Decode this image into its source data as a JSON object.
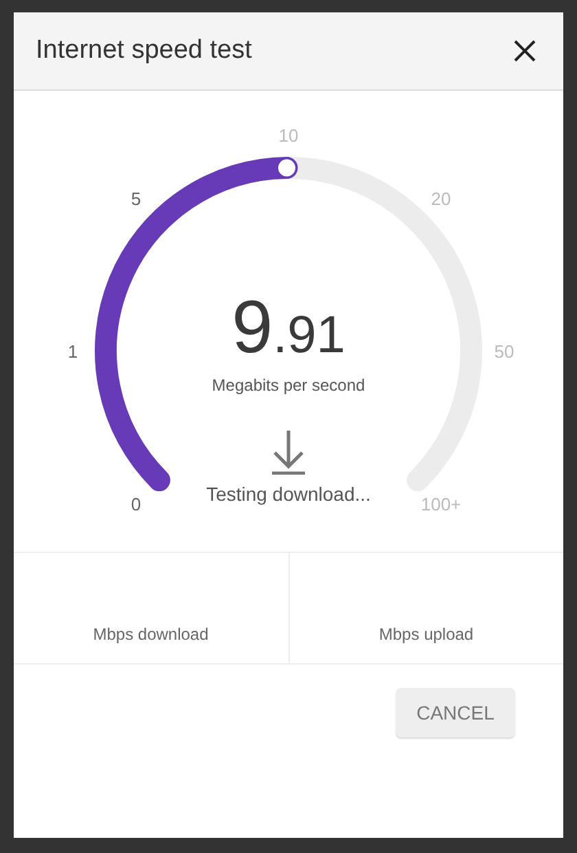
{
  "dialog": {
    "title": "Internet speed test"
  },
  "gauge": {
    "scale_labels": [
      "0",
      "1",
      "5",
      "10",
      "20",
      "50",
      "100+"
    ],
    "level": 0.498,
    "value_integer": "9",
    "value_fraction": ".91",
    "unit": "Megabits per second",
    "status": "Testing download..."
  },
  "stats": [
    {
      "label": "Mbps download"
    },
    {
      "label": "Mbps upload"
    }
  ],
  "buttons": [
    {
      "label": "CANCEL"
    }
  ]
}
